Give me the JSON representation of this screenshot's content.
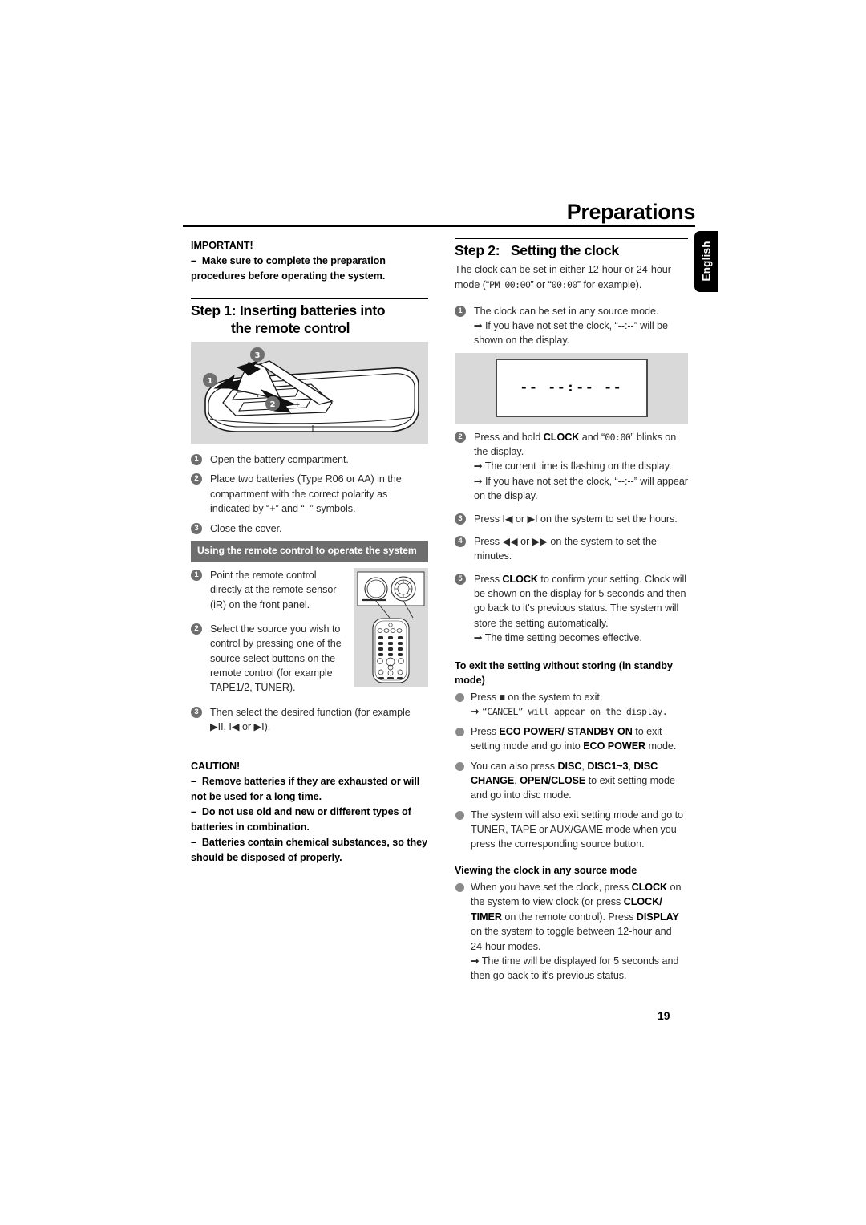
{
  "header": {
    "title": "Preparations",
    "language_tab": "English"
  },
  "page_number": "19",
  "left_column": {
    "important": {
      "heading": "IMPORTANT!",
      "dash_items": [
        "Make sure to complete the preparation procedures before operating the system."
      ]
    },
    "step1": {
      "label": "Step 1:",
      "title_line1": "Inserting batteries into",
      "title_line2": "the remote control",
      "figure_name": "remote-control-battery-compartment-illustration",
      "figure_callouts": [
        "1",
        "2",
        "3"
      ],
      "items": [
        "Open the battery compartment.",
        "Place two batteries (Type R06 or AA) in the compartment with the correct polarity as indicated by “+” and “–” symbols.",
        "Close the cover."
      ]
    },
    "remote_use": {
      "bar_heading": "Using the remote control to operate the system",
      "figure_name": "remote-sensor-and-remote-control-illustration",
      "items": [
        "Point the remote control directly at the remote sensor (iR) on the front panel.",
        "Select the source you wish to control by pressing one of the source select buttons on the remote control (for example TAPE1/2, TUNER).",
        "Then select the desired function (for example ▶II, I◀ or ▶I)."
      ]
    },
    "caution": {
      "heading": "CAUTION!",
      "dash_items": [
        "Remove batteries if they are exhausted or will not be used for a long time.",
        "Do not use old and new or different types of batteries in combination.",
        "Batteries contain chemical substances, so they should be disposed of properly."
      ]
    }
  },
  "right_column": {
    "step2": {
      "label": "Step 2:",
      "title": "Setting the clock",
      "intro_part1": "The clock can be set in either 12-hour or 24-hour mode (“",
      "intro_lcd1": "PM  00:00",
      "intro_part2": "” or “",
      "intro_lcd2": "00:00",
      "intro_part3": "” for example).",
      "items": [
        {
          "text": "The clock can be set in any source mode.",
          "arrows": [
            "If you have not set the clock, “--:--” will be shown on the display."
          ]
        },
        {
          "text_pre": "Press and hold ",
          "keyword": "CLOCK",
          "text_mid": " and “",
          "lcd": "00:00",
          "text_post": "” blinks on the display.",
          "arrows": [
            "The current time is flashing on the display.",
            "If you have not set the clock, “--:--” will appear on the display."
          ]
        },
        {
          "text": "Press  I◀  or ▶I on the system to set the hours.",
          "arrows": []
        },
        {
          "text": "Press ◀◀ or ▶▶ on the system to set the minutes.",
          "arrows": []
        },
        {
          "text_pre": "Press ",
          "keyword": "CLOCK",
          "text_post": " to confirm your setting.  Clock will be shown on the display for 5 seconds and then go back to it's previous status. The system will store the setting automatically.",
          "arrows": [
            "The time setting becomes effective."
          ]
        }
      ],
      "display_box": {
        "name": "clock-display-illustration",
        "value": "--  --:--  --"
      }
    },
    "exit_section": {
      "heading": "To exit the setting without storing (in standby mode)",
      "bullets": [
        {
          "text": "Press ■ on the system to exit.",
          "arrows": [
            "“CANCEL” will appear on the display."
          ]
        },
        {
          "text": "Press ECO POWER/ STANDBY ON to exit setting mode and go into ECO POWER mode.",
          "arrows": []
        },
        {
          "text": "You can also press DISC, DISC1~3, DISC CHANGE, OPEN/CLOSE to exit setting mode and go into disc mode.",
          "arrows": []
        },
        {
          "text": "The system will also exit setting mode and go to TUNER, TAPE or AUX/GAME mode when you press the corresponding source button.",
          "arrows": []
        }
      ]
    },
    "view_section": {
      "heading": "Viewing the clock in any source mode",
      "bullets": [
        {
          "text": "When you have set the clock, press CLOCK on the system to view clock (or press CLOCK/ TIMER on the remote control).  Press DISPLAY on the system to toggle between 12-hour and 24-hour modes.",
          "arrows": [
            "The time will be displayed for 5 seconds and then go back to it's previous status."
          ]
        }
      ]
    }
  }
}
